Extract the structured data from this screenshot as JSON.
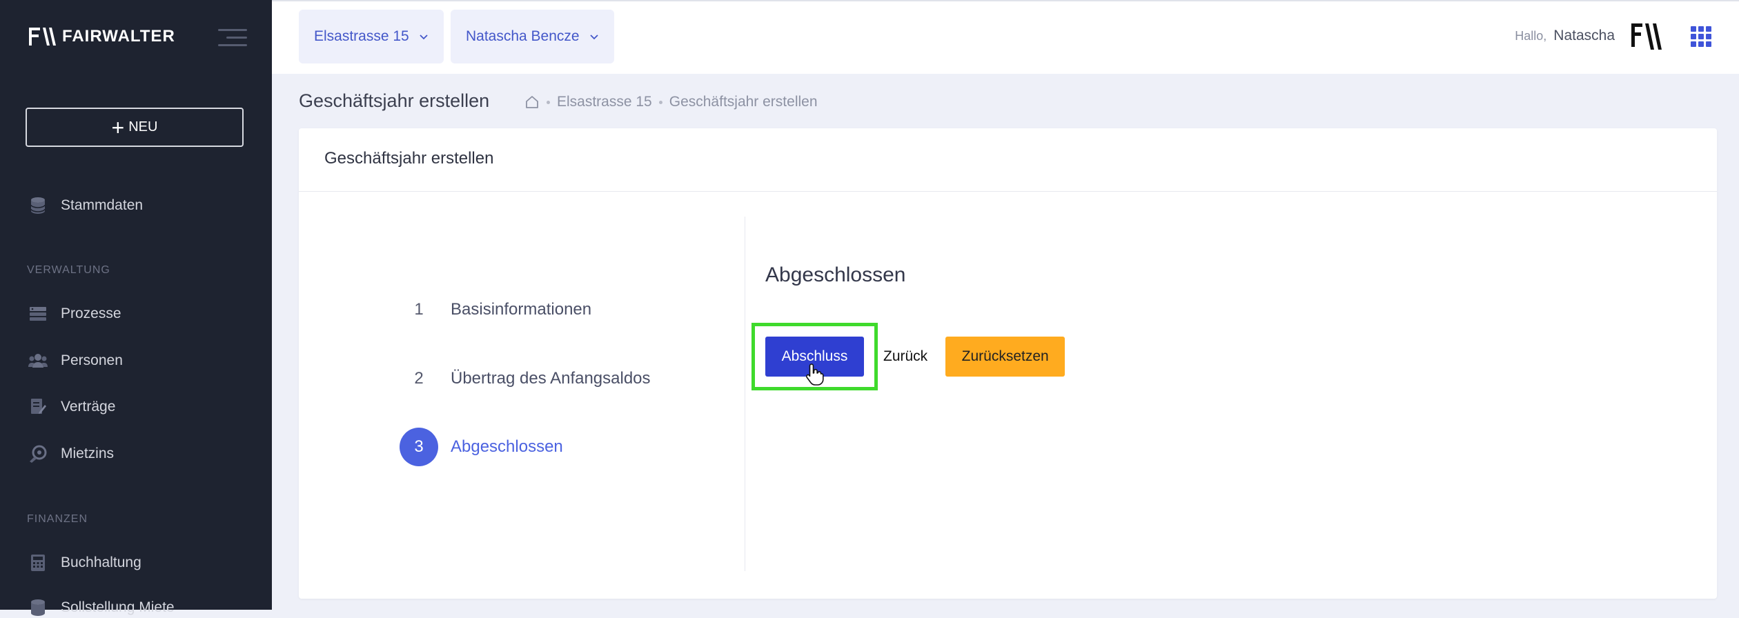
{
  "brand": {
    "name": "FAIRWALTER"
  },
  "sidebar": {
    "new_label": "NEU",
    "items_top": [
      {
        "label": "Stammdaten",
        "icon": "database-icon"
      }
    ],
    "section_verwaltung": "VERWALTUNG",
    "items_verwaltung": [
      {
        "label": "Prozesse",
        "icon": "server-icon"
      },
      {
        "label": "Personen",
        "icon": "users-icon"
      },
      {
        "label": "Verträge",
        "icon": "contract-icon"
      },
      {
        "label": "Mietzins",
        "icon": "rent-icon"
      }
    ],
    "section_finanzen": "FINANZEN",
    "items_finanzen": [
      {
        "label": "Buchhaltung",
        "icon": "calculator-icon"
      },
      {
        "label": "Sollstellung Miete",
        "icon": "database-icon"
      }
    ]
  },
  "topbar": {
    "property_selector": "Elsastrasse 15",
    "person_selector": "Natascha Bencze",
    "greeting": "Hallo,",
    "user_name": "Natascha"
  },
  "page": {
    "title": "Geschäftsjahr erstellen",
    "breadcrumb": [
      "Elsastrasse 15",
      "Geschäftsjahr erstellen"
    ]
  },
  "card": {
    "title": "Geschäftsjahr erstellen",
    "steps": [
      {
        "number": "1",
        "label": "Basisinformationen",
        "active": false
      },
      {
        "number": "2",
        "label": "Übertrag des Anfangsaldos",
        "active": false
      },
      {
        "number": "3",
        "label": "Abgeschlossen",
        "active": true
      }
    ],
    "content_title": "Abgeschlossen",
    "actions": {
      "finish": "Abschluss",
      "back": "Zurück",
      "reset": "Zurücksetzen"
    }
  },
  "colors": {
    "sidebar_bg": "#1e2330",
    "accent": "#4b62e0",
    "primary_button": "#2f3fd1",
    "warning_button": "#ffab1f",
    "focus_highlight": "#3fda2c"
  }
}
